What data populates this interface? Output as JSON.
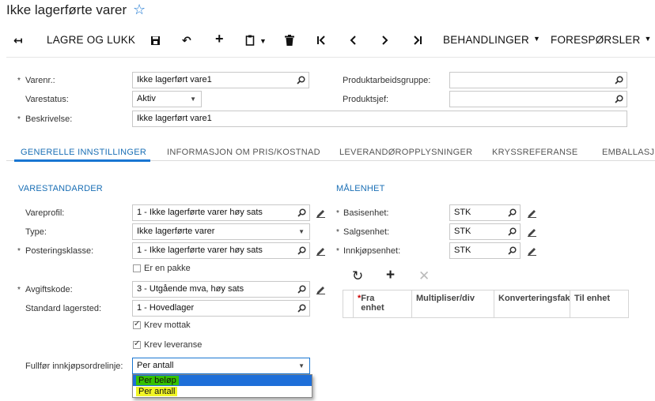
{
  "header": {
    "title": "Ikke lagerførte varer"
  },
  "toolbar": {
    "save_close": "LAGRE OG LUKK",
    "actions": "BEHANDLINGER",
    "inquiries": "FORESPØRSLER"
  },
  "summary": {
    "item_id_label": "Varenr.:",
    "item_id_value": "Ikke lagerført vare1",
    "status_label": "Varestatus:",
    "status_value": "Aktiv",
    "description_label": "Beskrivelse:",
    "description_value": "Ikke lagerført vare1",
    "product_workgroup_label": "Produktarbeidsgruppe:",
    "product_workgroup_value": "",
    "product_manager_label": "Produktsjef:",
    "product_manager_value": ""
  },
  "tabs": [
    {
      "label": "GENERELLE INNSTILLINGER"
    },
    {
      "label": "INFORMASJON OM PRIS/KOSTNAD"
    },
    {
      "label": "LEVERANDØROPPLYSNINGER"
    },
    {
      "label": "KRYSSREFERANSE"
    },
    {
      "label": "EMBALLASJE"
    }
  ],
  "defaults": {
    "heading": "VARESTANDARDER",
    "item_class_label": "Vareprofil:",
    "item_class_value": "1 - Ikke lagerførte varer høy sats",
    "type_label": "Type:",
    "type_value": "Ikke lagerførte varer",
    "posting_class_label": "Posteringsklasse:",
    "posting_class_value": "1 - Ikke lagerførte varer høy sats",
    "is_kit_label": "Er en pakke",
    "tax_category_label": "Avgiftskode:",
    "tax_category_value": "3 - Utgående mva, høy sats",
    "default_site_label": "Standard lagersted:",
    "default_site_value": "1 - Hovedlager",
    "require_receipt_label": "Krev mottak",
    "require_shipment_label": "Krev leveranse",
    "complete_po_label": "Fullfør innkjøpsordrelinje:",
    "complete_po_value": "Per antall",
    "complete_po_options": [
      "Per beløp",
      "Per antall"
    ]
  },
  "uom": {
    "heading": "MÅLENHET",
    "base_label": "Basisenhet:",
    "base_value": "STK",
    "sales_label": "Salgsenhet:",
    "sales_value": "STK",
    "purchase_label": "Innkjøpsenhet:",
    "purchase_value": "STK",
    "grid_columns": [
      "Fra enhet",
      "Multipliser/div",
      "Konverteringsfak",
      "Til enhet"
    ]
  }
}
